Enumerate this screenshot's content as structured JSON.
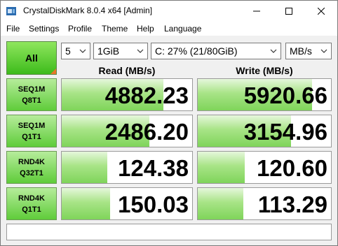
{
  "window": {
    "title": "CrystalDiskMark 8.0.4 x64 [Admin]"
  },
  "menu": [
    "File",
    "Settings",
    "Profile",
    "Theme",
    "Help",
    "Language"
  ],
  "controls": {
    "all_label": "All",
    "count": "5",
    "size": "1GiB",
    "drive": "C: 27% (21/80GiB)",
    "unit": "MB/s"
  },
  "headers": {
    "read": "Read (MB/s)",
    "write": "Write (MB/s)"
  },
  "rows": [
    {
      "line1": "SEQ1M",
      "line2": "Q8T1",
      "read": "4882.23",
      "write": "5920.66",
      "read_fill": 0.78,
      "write_fill": 0.86
    },
    {
      "line1": "SEQ1M",
      "line2": "Q1T1",
      "read": "2486.20",
      "write": "3154.96",
      "read_fill": 0.67,
      "write_fill": 0.7
    },
    {
      "line1": "RND4K",
      "line2": "Q32T1",
      "read": "124.38",
      "write": "120.60",
      "read_fill": 0.35,
      "write_fill": 0.35
    },
    {
      "line1": "RND4K",
      "line2": "Q1T1",
      "read": "150.03",
      "write": "113.29",
      "read_fill": 0.37,
      "write_fill": 0.34
    }
  ],
  "comment": ""
}
